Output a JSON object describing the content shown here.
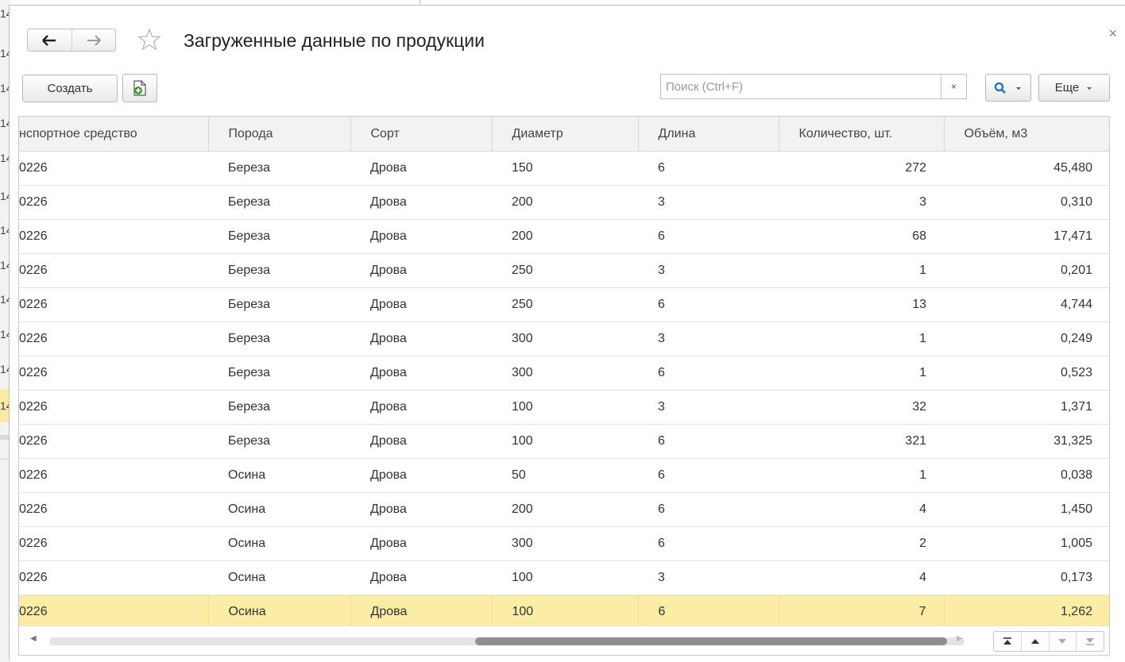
{
  "background": {
    "rows": [
      "14",
      "14",
      "14",
      "14",
      "14",
      "14",
      "14",
      "14",
      "14",
      "14",
      "14",
      "14"
    ]
  },
  "window": {
    "title": "Загруженные данные по продукции",
    "close_label": "×",
    "nav": {
      "back_icon": "arrow-left-icon",
      "forward_icon": "arrow-right-icon"
    },
    "favorite_icon": "star-outline-icon"
  },
  "toolbar": {
    "create_label": "Создать",
    "add_file_icon": "document-add-icon",
    "search_placeholder": "Поиск (Ctrl+F)",
    "search_clear_label": "×",
    "search_icon": "magnifier-icon",
    "more_label": "Еще"
  },
  "table": {
    "columns": [
      "нспортное средство",
      "Порода",
      "Сорт",
      "Диаметр",
      "Длина",
      "Количество, шт.",
      "Объём, м3"
    ],
    "rows": [
      [
        "0226",
        "Береза",
        "Дрова",
        "150",
        "6",
        "272",
        "45,480"
      ],
      [
        "0226",
        "Береза",
        "Дрова",
        "200",
        "3",
        "3",
        "0,310"
      ],
      [
        "0226",
        "Береза",
        "Дрова",
        "200",
        "6",
        "68",
        "17,471"
      ],
      [
        "0226",
        "Береза",
        "Дрова",
        "250",
        "3",
        "1",
        "0,201"
      ],
      [
        "0226",
        "Береза",
        "Дрова",
        "250",
        "6",
        "13",
        "4,744"
      ],
      [
        "0226",
        "Береза",
        "Дрова",
        "300",
        "3",
        "1",
        "0,249"
      ],
      [
        "0226",
        "Береза",
        "Дрова",
        "300",
        "6",
        "1",
        "0,523"
      ],
      [
        "0226",
        "Береза",
        "Дрова",
        "100",
        "3",
        "32",
        "1,371"
      ],
      [
        "0226",
        "Береза",
        "Дрова",
        "100",
        "6",
        "321",
        "31,325"
      ],
      [
        "0226",
        "Осина",
        "Дрова",
        "50",
        "6",
        "1",
        "0,038"
      ],
      [
        "0226",
        "Осина",
        "Дрова",
        "200",
        "6",
        "4",
        "1,450"
      ],
      [
        "0226",
        "Осина",
        "Дрова",
        "300",
        "6",
        "2",
        "1,005"
      ],
      [
        "0226",
        "Осина",
        "Дрова",
        "100",
        "3",
        "4",
        "0,173"
      ],
      [
        "0226",
        "Осина",
        "Дрова",
        "100",
        "6",
        "7",
        "1,262"
      ]
    ],
    "selected_row": 13,
    "horizontal_scroll_fraction": 0.55
  },
  "colors": {
    "selected_row": "#fbeca6",
    "header_bg": "#f2f2f2",
    "search_accent": "#1f6fb8"
  }
}
